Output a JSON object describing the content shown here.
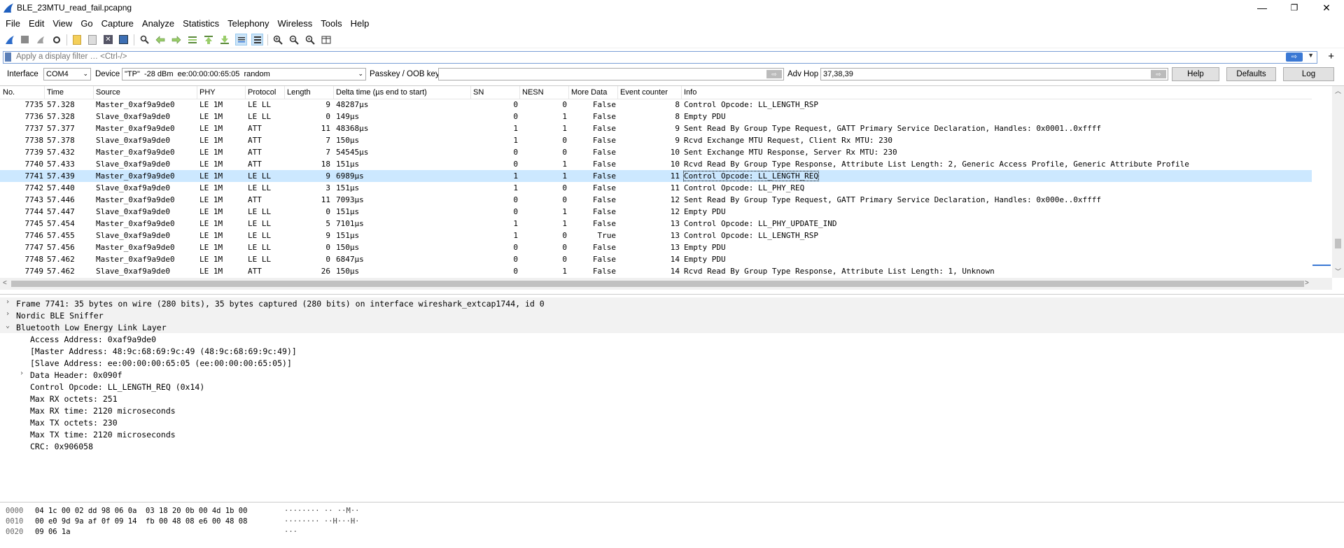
{
  "window": {
    "title": "BLE_23MTU_read_fail.pcapng",
    "minimize": "—",
    "restore": "❐",
    "close": "✕"
  },
  "menu": [
    "File",
    "Edit",
    "View",
    "Go",
    "Capture",
    "Analyze",
    "Statistics",
    "Telephony",
    "Wireless",
    "Tools",
    "Help"
  ],
  "toolbar_icons": [
    "shark-fin-start-icon",
    "stop-icon",
    "restart-icon",
    "options-icon",
    "open-file-icon",
    "save-file-icon",
    "close-file-icon",
    "reload-icon",
    "find-icon",
    "back-icon",
    "forward-icon",
    "go-to-packet-icon",
    "first-packet-icon",
    "last-packet-icon",
    "autoscroll-icon",
    "colorize-icon",
    "zoom-in-icon",
    "zoom-out-icon",
    "zoom-reset-icon",
    "resize-columns-icon"
  ],
  "filter": {
    "placeholder": "Apply a display filter … <Ctrl-/>",
    "apply": "⇨",
    "plus": "+"
  },
  "sniffer": {
    "interface_label": "Interface",
    "interface_value": "COM4",
    "device_label": "Device",
    "device_value": "\"TP\"  -28 dBm  ee:00:00:00:65:05  random",
    "passkey_label": "Passkey / OOB key",
    "passkey_value": "",
    "advhop_label": "Adv Hop",
    "advhop_value": "37,38,39",
    "help": "Help",
    "defaults": "Defaults",
    "log": "Log"
  },
  "columns": [
    "No.",
    "Time",
    "Source",
    "PHY",
    "Protocol",
    "Length",
    "Delta time (µs end to start)",
    "SN",
    "NESN",
    "More Data",
    "Event counter",
    "Info"
  ],
  "packets": [
    {
      "no": "7735",
      "time": "57.328",
      "src": "Master_0xaf9a9de0",
      "phy": "LE 1M",
      "proto": "LE LL",
      "len": "9",
      "delta": "48287µs",
      "sn": "0",
      "nesn": "0",
      "more": "False",
      "ev": "8",
      "info": "Control Opcode: LL_LENGTH_RSP"
    },
    {
      "no": "7736",
      "time": "57.328",
      "src": "Slave_0xaf9a9de0",
      "phy": "LE 1M",
      "proto": "LE LL",
      "len": "0",
      "delta": "149µs",
      "sn": "0",
      "nesn": "1",
      "more": "False",
      "ev": "8",
      "info": "Empty PDU"
    },
    {
      "no": "7737",
      "time": "57.377",
      "src": "Master_0xaf9a9de0",
      "phy": "LE 1M",
      "proto": "ATT",
      "len": "11",
      "delta": "48368µs",
      "sn": "1",
      "nesn": "1",
      "more": "False",
      "ev": "9",
      "info": "Sent Read By Group Type Request, GATT Primary Service Declaration, Handles: 0x0001..0xffff"
    },
    {
      "no": "7738",
      "time": "57.378",
      "src": "Slave_0xaf9a9de0",
      "phy": "LE 1M",
      "proto": "ATT",
      "len": "7",
      "delta": "150µs",
      "sn": "1",
      "nesn": "0",
      "more": "False",
      "ev": "9",
      "info": "Rcvd Exchange MTU Request, Client Rx MTU: 230"
    },
    {
      "no": "7739",
      "time": "57.432",
      "src": "Master_0xaf9a9de0",
      "phy": "LE 1M",
      "proto": "ATT",
      "len": "7",
      "delta": "54545µs",
      "sn": "0",
      "nesn": "0",
      "more": "False",
      "ev": "10",
      "info": "Sent Exchange MTU Response, Server Rx MTU: 230"
    },
    {
      "no": "7740",
      "time": "57.433",
      "src": "Slave_0xaf9a9de0",
      "phy": "LE 1M",
      "proto": "ATT",
      "len": "18",
      "delta": "151µs",
      "sn": "0",
      "nesn": "1",
      "more": "False",
      "ev": "10",
      "info": "Rcvd Read By Group Type Response, Attribute List Length: 2, Generic Access Profile, Generic Attribute Profile"
    },
    {
      "no": "7741",
      "time": "57.439",
      "src": "Master_0xaf9a9de0",
      "phy": "LE 1M",
      "proto": "LE LL",
      "len": "9",
      "delta": "6989µs",
      "sn": "1",
      "nesn": "1",
      "more": "False",
      "ev": "11",
      "info": "Control Opcode: LL_LENGTH_REQ"
    },
    {
      "no": "7742",
      "time": "57.440",
      "src": "Slave_0xaf9a9de0",
      "phy": "LE 1M",
      "proto": "LE LL",
      "len": "3",
      "delta": "151µs",
      "sn": "1",
      "nesn": "0",
      "more": "False",
      "ev": "11",
      "info": "Control Opcode: LL_PHY_REQ"
    },
    {
      "no": "7743",
      "time": "57.446",
      "src": "Master_0xaf9a9de0",
      "phy": "LE 1M",
      "proto": "ATT",
      "len": "11",
      "delta": "7093µs",
      "sn": "0",
      "nesn": "0",
      "more": "False",
      "ev": "12",
      "info": "Sent Read By Group Type Request, GATT Primary Service Declaration, Handles: 0x000e..0xffff"
    },
    {
      "no": "7744",
      "time": "57.447",
      "src": "Slave_0xaf9a9de0",
      "phy": "LE 1M",
      "proto": "LE LL",
      "len": "0",
      "delta": "151µs",
      "sn": "0",
      "nesn": "1",
      "more": "False",
      "ev": "12",
      "info": "Empty PDU"
    },
    {
      "no": "7745",
      "time": "57.454",
      "src": "Master_0xaf9a9de0",
      "phy": "LE 1M",
      "proto": "LE LL",
      "len": "5",
      "delta": "7101µs",
      "sn": "1",
      "nesn": "1",
      "more": "False",
      "ev": "13",
      "info": "Control Opcode: LL_PHY_UPDATE_IND"
    },
    {
      "no": "7746",
      "time": "57.455",
      "src": "Slave_0xaf9a9de0",
      "phy": "LE 1M",
      "proto": "LE LL",
      "len": "9",
      "delta": "151µs",
      "sn": "1",
      "nesn": "0",
      "more": "True",
      "ev": "13",
      "info": "Control Opcode: LL_LENGTH_RSP"
    },
    {
      "no": "7747",
      "time": "57.456",
      "src": "Master_0xaf9a9de0",
      "phy": "LE 1M",
      "proto": "LE LL",
      "len": "0",
      "delta": "150µs",
      "sn": "0",
      "nesn": "0",
      "more": "False",
      "ev": "13",
      "info": "Empty PDU"
    },
    {
      "no": "7748",
      "time": "57.462",
      "src": "Master_0xaf9a9de0",
      "phy": "LE 1M",
      "proto": "LE LL",
      "len": "0",
      "delta": "6847µs",
      "sn": "0",
      "nesn": "0",
      "more": "False",
      "ev": "14",
      "info": "Empty PDU"
    },
    {
      "no": "7749",
      "time": "57.462",
      "src": "Slave_0xaf9a9de0",
      "phy": "LE 1M",
      "proto": "ATT",
      "len": "26",
      "delta": "150µs",
      "sn": "0",
      "nesn": "1",
      "more": "False",
      "ev": "14",
      "info": "Rcvd Read By Group Type Response, Attribute List Length: 1, Unknown"
    }
  ],
  "selected_no": "7741",
  "details": [
    {
      "level": 0,
      "exp": ">",
      "text": "Frame 7741: 35 bytes on wire (280 bits), 35 bytes captured (280 bits) on interface wireshark_extcap1744, id 0"
    },
    {
      "level": 0,
      "exp": ">",
      "text": "Nordic BLE Sniffer"
    },
    {
      "level": 0,
      "exp": "v",
      "text": "Bluetooth Low Energy Link Layer"
    },
    {
      "level": 1,
      "exp": "",
      "text": "Access Address: 0xaf9a9de0"
    },
    {
      "level": 1,
      "exp": "",
      "text": "[Master Address: 48:9c:68:69:9c:49 (48:9c:68:69:9c:49)]"
    },
    {
      "level": 1,
      "exp": "",
      "text": "[Slave Address: ee:00:00:00:65:05 (ee:00:00:00:65:05)]"
    },
    {
      "level": 1,
      "exp": ">",
      "text": "Data Header: 0x090f"
    },
    {
      "level": 1,
      "exp": "",
      "text": "Control Opcode: LL_LENGTH_REQ (0x14)"
    },
    {
      "level": 1,
      "exp": "",
      "text": "Max RX octets: 251"
    },
    {
      "level": 1,
      "exp": "",
      "text": "Max RX time: 2120 microseconds"
    },
    {
      "level": 1,
      "exp": "",
      "text": "Max TX octets: 230"
    },
    {
      "level": 1,
      "exp": "",
      "text": "Max TX time: 2120 microseconds"
    },
    {
      "level": 1,
      "exp": "",
      "text": "CRC: 0x906058"
    }
  ],
  "hex": [
    {
      "off": "0000",
      "bytes": "04 1c 00 02 dd 98 06 0a  03 18 20 0b 00 4d 1b 00",
      "ascii": "········ ·· ··M··"
    },
    {
      "off": "0010",
      "bytes": "00 e0 9d 9a af 0f 09 14  fb 00 48 08 e6 00 48 08",
      "ascii": "········ ··H···H·"
    },
    {
      "off": "0020",
      "bytes": "09 06 1a",
      "ascii": "···"
    }
  ]
}
